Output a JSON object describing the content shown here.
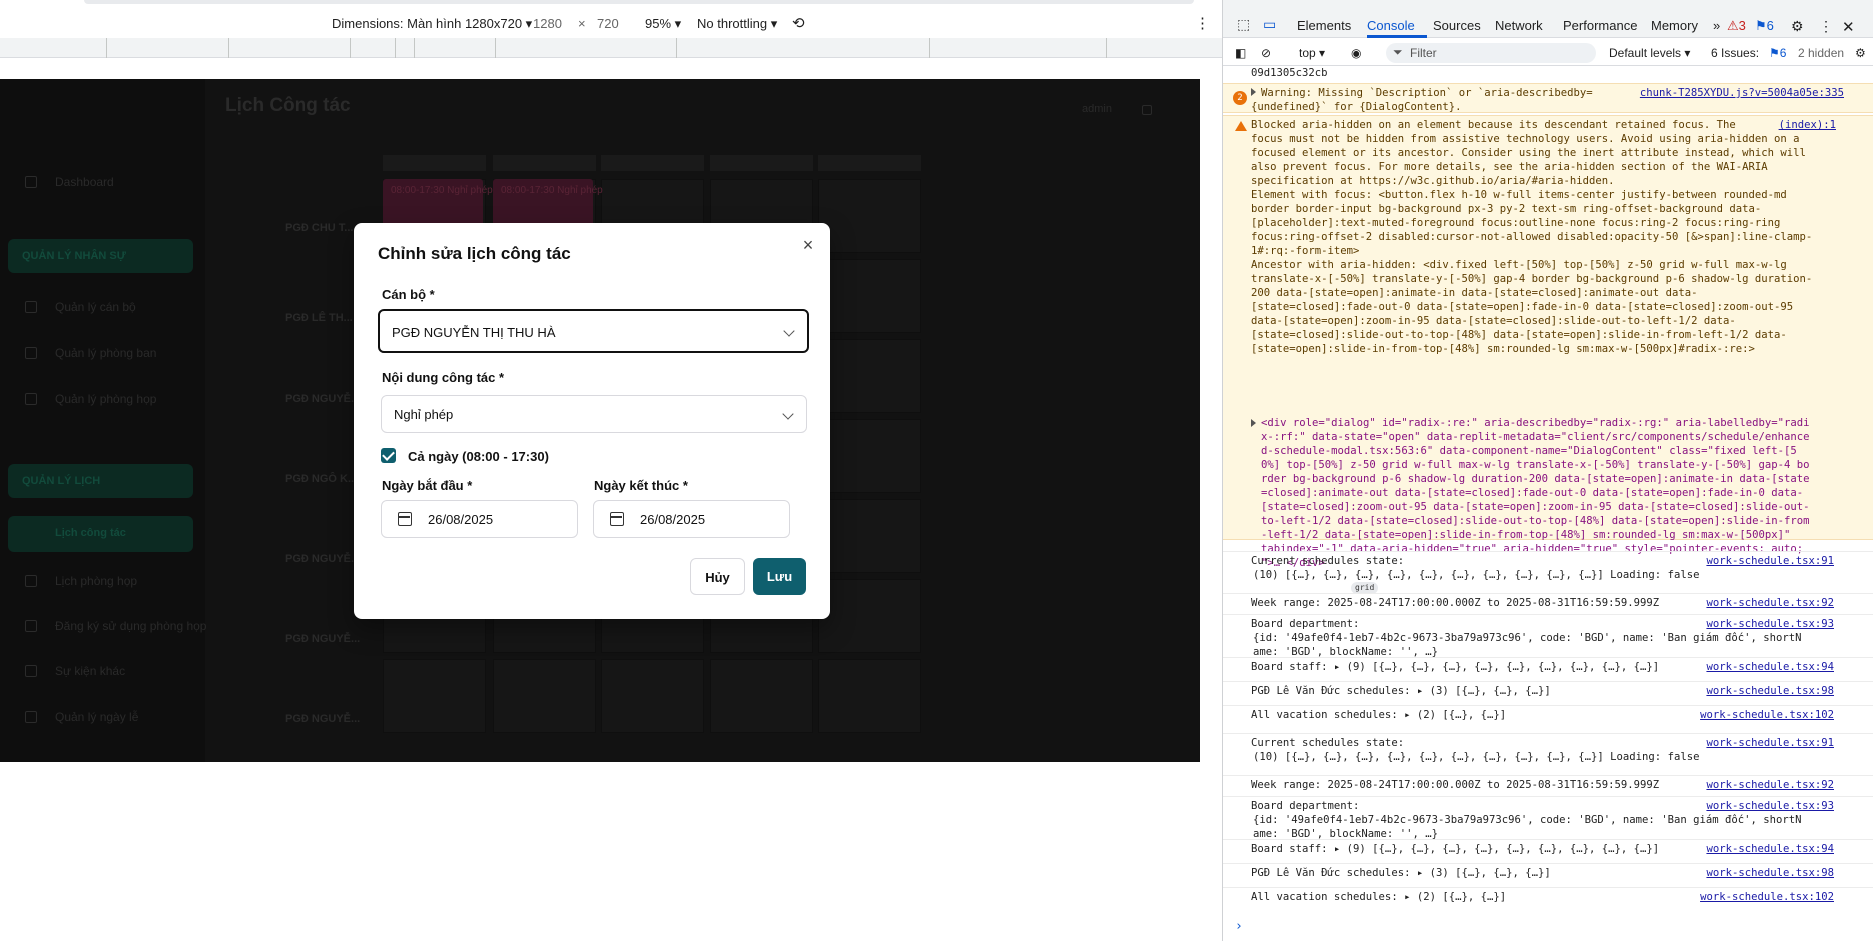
{
  "device_toolbar": {
    "dimensions_label": "Dimensions: Màn hình 1280x720",
    "width": "1280",
    "times": "×",
    "height": "720",
    "zoom": "95%",
    "throttling": "No throttling"
  },
  "app": {
    "title": "Lịch Công tác",
    "user_name": "admin",
    "sidebar": {
      "dashboard": "Dashboard",
      "section_hr": "QUẢN LÝ NHÂN SỰ",
      "hr_items": [
        "Quản lý cán bộ",
        "Quản lý phòng ban",
        "Quản lý phòng họp"
      ],
      "section_schedule": "QUẢN LÝ LỊCH",
      "schedule_items": [
        "Lịch công tác",
        "Lịch phòng họp",
        "Đăng ký sử dụng phòng họp",
        "Sự kiện khác",
        "Quản lý ngày lễ"
      ]
    },
    "rows": [
      "PGĐ CHU T...",
      "PGĐ LÊ TH...",
      "PGĐ NGUYỄ...",
      "PGĐ NGÔ K...",
      "PGĐ NGUYỄ...",
      "PGĐ NGUYỄ...",
      "PGĐ NGUYỄ..."
    ],
    "events": [
      "08:00-17:30 Nghỉ phép",
      "08:00-17:30 Nghỉ phép"
    ]
  },
  "dialog": {
    "title": "Chỉnh sửa lịch công tác",
    "staff_label": "Cán bộ *",
    "staff_value": "PGĐ NGUYỄN THỊ THU HÀ",
    "content_label": "Nội dung công tác *",
    "content_value": "Nghỉ phép",
    "all_day_label": "Cả ngày (08:00 - 17:30)",
    "start_label": "Ngày bắt đầu *",
    "start_value": "26/08/2025",
    "end_label": "Ngày kết thúc *",
    "end_value": "26/08/2025",
    "cancel_label": "Hủy",
    "save_label": "Lưu",
    "close_glyph": "×"
  },
  "devtools": {
    "tabs": [
      "Elements",
      "Console",
      "Sources",
      "Network",
      "Performance",
      "Memory"
    ],
    "active_tab": "Console",
    "more_tabs": "»",
    "warn_count": "3",
    "msg_count": "6",
    "context": "top",
    "filter_placeholder": "Filter",
    "levels": "Default levels",
    "issues_label": "6 Issues:",
    "issues_count": "6",
    "hidden": "2 hidden"
  },
  "console": {
    "first_line": "09d1305c32cb",
    "warn1_count": "2",
    "warn1_text": "Warning: Missing `Description` or `aria-describedby=\n{undefined}` for {DialogContent}.",
    "warn1_src": "chunk-T285XYDU.js?v=5004a05e:335",
    "warn2_text": "Blocked aria-hidden on an element because its descendant retained focus. The\nfocus must not be hidden from assistive technology users. Avoid using aria-hidden on a\nfocused element or its ancestor. Consider using the inert attribute instead, which will\nalso prevent focus. For more details, see the aria-hidden section of the WAI-ARIA\nspecification at https://w3c.github.io/aria/#aria-hidden.\nElement with focus: <button.flex h-10 w-full items-center justify-between rounded-md\nborder border-input bg-background px-3 py-2 text-sm ring-offset-background data-\n[placeholder]:text-muted-foreground focus:outline-none focus:ring-2 focus:ring-ring\nfocus:ring-offset-2 disabled:cursor-not-allowed disabled:opacity-50 [&>span]:line-clamp-\n1#:rq:-form-item>\nAncestor with aria-hidden: <div.fixed left-[50%] top-[50%] z-50 grid w-full max-w-lg\ntranslate-x-[-50%] translate-y-[-50%] gap-4 border bg-background p-6 shadow-lg duration-\n200 data-[state=open]:animate-in data-[state=closed]:animate-out data-\n[state=closed]:fade-out-0 data-[state=open]:fade-in-0 data-[state=closed]:zoom-out-95\ndata-[state=open]:zoom-in-95 data-[state=closed]:slide-out-to-left-1/2 data-\n[state=closed]:slide-out-to-top-[48%] data-[state=open]:slide-in-from-left-1/2 data-\n[state=open]:slide-in-from-top-[48%] sm:rounded-lg sm:max-w-[500px]#radix-:re:>",
    "warn2_src": "(index):1",
    "html_node": "<div role=\"dialog\" id=\"radix-:re:\" aria-describedby=\"radix-:rg:\" aria-labelledby=\"radi\nx-:rf:\" data-state=\"open\" data-replit-metadata=\"client/src/components/schedule/enhance\nd-schedule-modal.tsx:563:6\" data-component-name=\"DialogContent\" class=\"fixed left-[5\n0%] top-[50%] z-50 grid w-full max-w-lg translate-x-[-50%] translate-y-[-50%] gap-4 bo\nrder bg-background p-6 shadow-lg duration-200 data-[state=open]:animate-in data-[state\n=closed]:animate-out data-[state=closed]:fade-out-0 data-[state=open]:fade-in-0 data-\n[state=closed]:zoom-out-95 data-[state=open]:zoom-in-95 data-[state=closed]:slide-out-\nto-left-1/2 data-[state=closed]:slide-out-to-top-[48%] data-[state=open]:slide-in-from\n-left-1/2 data-[state=open]:slide-in-from-top-[48%] sm:rounded-lg sm:max-w-[500px]\"\ntabindex=\"-1\" data-aria-hidden=\"true\" aria-hidden=\"true\" style=\"pointer-events: auto;\n\">… </div>",
    "grid_badge": "grid",
    "logs": [
      {
        "text": "Current schedules state:",
        "sub": "(10) [{…}, {…}, {…}, {…}, {…}, {…}, {…}, {…}, {…}, {…}] Loading: false",
        "src": "work-schedule.tsx:91"
      },
      {
        "text": "Week range: 2025-08-24T17:00:00.000Z to 2025-08-31T16:59:59.999Z",
        "src": "work-schedule.tsx:92"
      },
      {
        "text": "Board department:",
        "sub": "{id: '49afe0f4-1eb7-4b2c-9673-3ba79a973c96', code: 'BGD', name: 'Ban giám đốc', shortN\name: 'BGD', blockName: '', …}",
        "src": "work-schedule.tsx:93"
      },
      {
        "text": "Board staff: ▸ (9) [{…}, {…}, {…}, {…}, {…}, {…}, {…}, {…}, {…}]",
        "src": "work-schedule.tsx:94"
      },
      {
        "text": "PGĐ Lê Văn Đức schedules: ▸ (3) [{…}, {…}, {…}]",
        "src": "work-schedule.tsx:98"
      },
      {
        "text": "All vacation schedules: ▸ (2) [{…}, {…}]",
        "src": "work-schedule.tsx:102"
      },
      {
        "text": "Current schedules state:",
        "sub": "(10) [{…}, {…}, {…}, {…}, {…}, {…}, {…}, {…}, {…}, {…}] Loading: false",
        "src": "work-schedule.tsx:91"
      },
      {
        "text": "Week range: 2025-08-24T17:00:00.000Z to 2025-08-31T16:59:59.999Z",
        "src": "work-schedule.tsx:92"
      },
      {
        "text": "Board department:",
        "sub": "{id: '49afe0f4-1eb7-4b2c-9673-3ba79a973c96', code: 'BGD', name: 'Ban giám đốc', shortN\name: 'BGD', blockName: '', …}",
        "src": "work-schedule.tsx:93"
      },
      {
        "text": "Board staff: ▸ (9) [{…}, {…}, {…}, {…}, {…}, {…}, {…}, {…}, {…}]",
        "src": "work-schedule.tsx:94"
      },
      {
        "text": "PGĐ Lê Văn Đức schedules: ▸ (3) [{…}, {…}, {…}]",
        "src": "work-schedule.tsx:98"
      },
      {
        "text": "All vacation schedules: ▸ (2) [{…}, {…}]",
        "src": "work-schedule.tsx:102"
      }
    ],
    "prompt": "›"
  },
  "colors": {
    "accent": "#0f5f6e",
    "devtools_blue": "#0b57d0",
    "warning_bg": "#fef7e0"
  }
}
